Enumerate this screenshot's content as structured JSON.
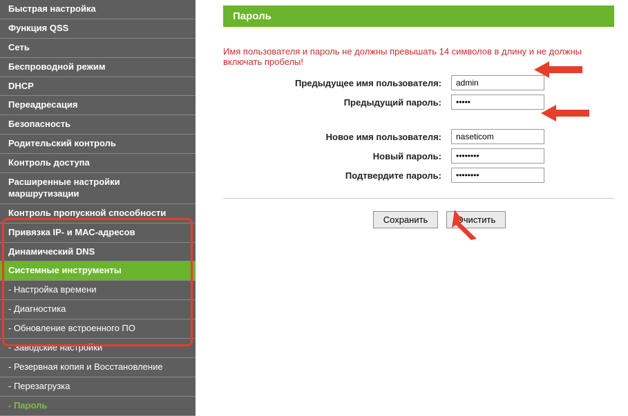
{
  "sidebar": {
    "items": [
      {
        "label": "Быстрая настройка"
      },
      {
        "label": "Функция QSS"
      },
      {
        "label": "Сеть"
      },
      {
        "label": "Беспроводной режим"
      },
      {
        "label": "DHCP"
      },
      {
        "label": "Переадресация"
      },
      {
        "label": "Безопасность"
      },
      {
        "label": "Родительский контроль"
      },
      {
        "label": "Контроль доступа"
      },
      {
        "label": "Расширенные настройки маршрутизации"
      },
      {
        "label": "Контроль пропускной способности"
      },
      {
        "label": "Привязка IP- и МАС-адресов"
      },
      {
        "label": "Динамический DNS"
      },
      {
        "label": "Системные инструменты"
      },
      {
        "label": "- Настройка времени"
      },
      {
        "label": "- Диагностика"
      },
      {
        "label": "- Обновление встроенного ПО"
      },
      {
        "label": "- Заводские настройки"
      },
      {
        "label": "- Резервная копия и Восстановление"
      },
      {
        "label": "- Перезагрузка"
      },
      {
        "label": "- Пароль"
      }
    ]
  },
  "page": {
    "title": "Пароль",
    "warning": "Имя пользователя и пароль не должны превышать 14 символов в длину и не должны включать пробелы!",
    "labels": {
      "prev_user": "Предыдущее имя пользователя:",
      "prev_pass": "Предыдущий пароль:",
      "new_user": "Новое имя пользователя:",
      "new_pass": "Новый пароль:",
      "confirm_pass": "Подтвердите пароль:"
    },
    "values": {
      "prev_user": "admin",
      "prev_pass": "•••••",
      "new_user": "naseticom",
      "new_pass": "••••••••",
      "confirm_pass": "••••••••"
    },
    "buttons": {
      "save": "Сохранить",
      "clear": "Очистить"
    }
  }
}
